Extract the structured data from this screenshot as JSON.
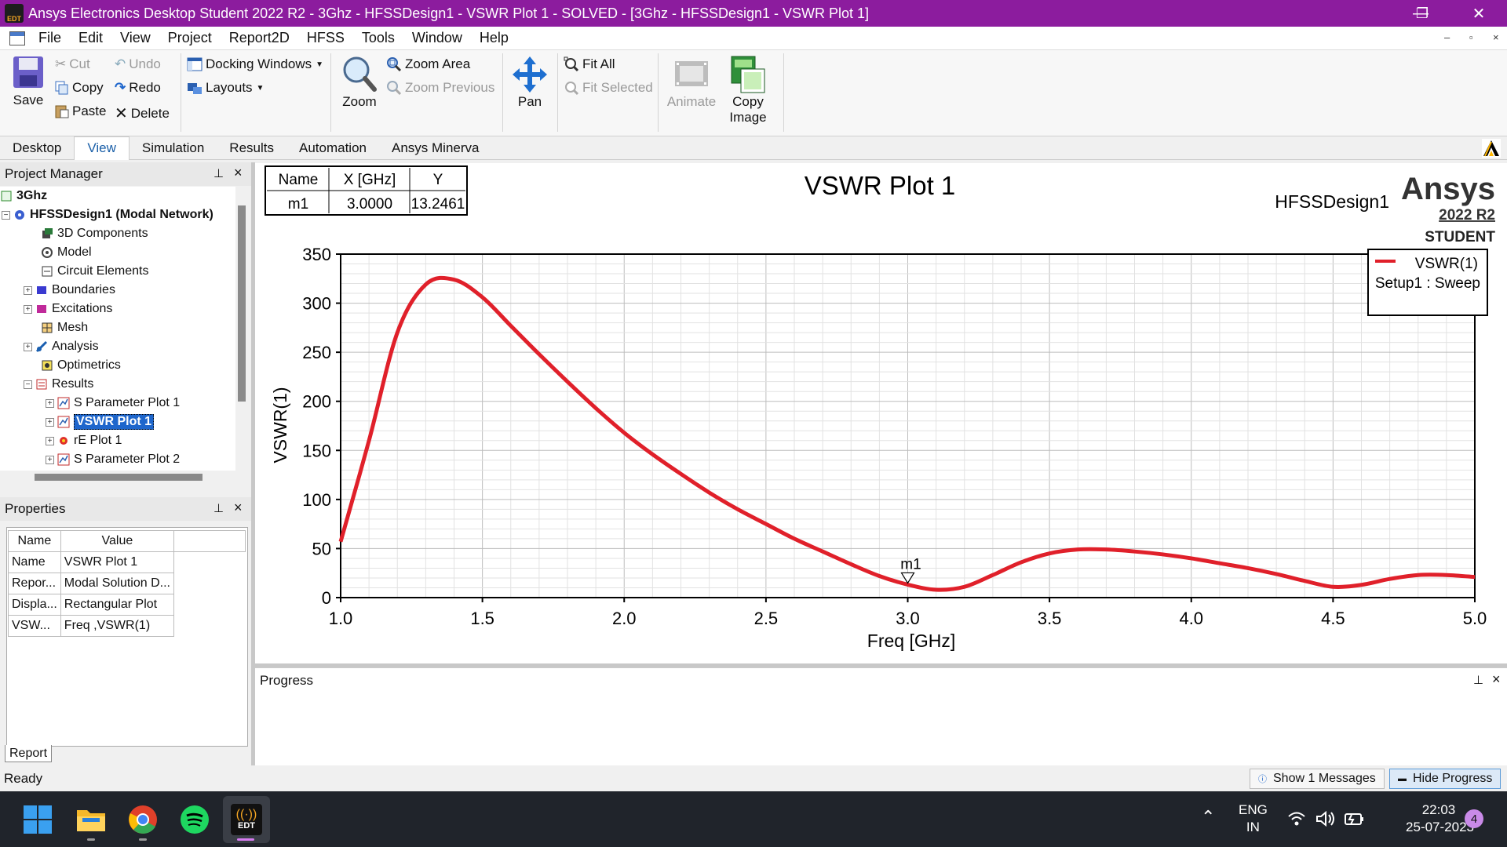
{
  "window": {
    "title": "Ansys Electronics Desktop Student 2022 R2 - 3Ghz - HFSSDesign1 - VSWR Plot 1 - SOLVED - [3Ghz - HFSSDesign1 - VSWR Plot 1]",
    "app_badge": "EDT",
    "minimize": "—",
    "restore": "❐",
    "close": "✕"
  },
  "menu": {
    "items": [
      "File",
      "Edit",
      "View",
      "Project",
      "Report2D",
      "HFSS",
      "Tools",
      "Window",
      "Help"
    ],
    "mdi_minimize": "–",
    "mdi_restore": "▫",
    "mdi_close": "×"
  },
  "ribbon": {
    "save": "Save",
    "cut": "Cut",
    "copy": "Copy",
    "paste": "Paste",
    "undo": "Undo",
    "redo": "Redo",
    "delete": "Delete",
    "docking_windows": "Docking Windows",
    "layouts": "Layouts",
    "zoom": "Zoom",
    "zoom_area": "Zoom Area",
    "zoom_previous": "Zoom Previous",
    "pan": "Pan",
    "fit_all": "Fit All",
    "fit_selected": "Fit Selected",
    "animate": "Animate",
    "copy_image_1": "Copy",
    "copy_image_2": "Image"
  },
  "tabs": [
    "Desktop",
    "View",
    "Simulation",
    "Results",
    "Automation",
    "Ansys Minerva"
  ],
  "project_manager": {
    "title": "Project Manager",
    "pin": "⊥",
    "close": "×",
    "tree": {
      "project": "3Ghz",
      "design": "HFSSDesign1 (Modal Network)",
      "children": [
        "3D Components",
        "Model",
        "Circuit Elements",
        "Boundaries",
        "Excitations",
        "Mesh",
        "Analysis",
        "Optimetrics",
        "Results"
      ],
      "results": [
        "S Parameter Plot 1",
        "VSWR Plot 1",
        "rE Plot 1",
        "S Parameter Plot 2"
      ]
    }
  },
  "properties": {
    "title": "Properties",
    "pin": "⊥",
    "close": "×",
    "headers": [
      "Name",
      "Value"
    ],
    "rows": [
      [
        "Name",
        "VSWR Plot 1"
      ],
      [
        "Repor...",
        "Modal Solution D..."
      ],
      [
        "Displa...",
        "Rectangular Plot"
      ],
      [
        "VSW...",
        "Freq ,VSWR(1)"
      ]
    ],
    "tab": "Report"
  },
  "plot": {
    "design_label": "HFSSDesign1",
    "brand": "Ansys",
    "version": "2022 R2",
    "edition": "STUDENT",
    "marker_table": {
      "headers": [
        "Name",
        "X [GHz]",
        "Y"
      ],
      "row": [
        "m1",
        "3.0000",
        "13.2461"
      ]
    },
    "legend": {
      "line1": "VSWR(1)",
      "line2": "Setup1 : Sweep"
    },
    "marker_label": "m1"
  },
  "chart_data": {
    "type": "line",
    "title": "VSWR Plot 1",
    "xlabel": "Freq [GHz]",
    "ylabel": "VSWR(1)",
    "xlim": [
      1.0,
      5.0
    ],
    "ylim": [
      0,
      350
    ],
    "xticks": [
      "1.0",
      "1.5",
      "2.0",
      "2.5",
      "3.0",
      "3.5",
      "4.0",
      "4.5",
      "5.0"
    ],
    "yticks": [
      "0",
      "50",
      "100",
      "150",
      "200",
      "250",
      "300",
      "350"
    ],
    "grid": true,
    "legend_position": "top-right",
    "series": [
      {
        "name": "VSWR(1)",
        "color": "#e0202a",
        "x": [
          1.0,
          1.1,
          1.2,
          1.3,
          1.4,
          1.5,
          1.6,
          1.7,
          1.8,
          1.9,
          2.0,
          2.1,
          2.2,
          2.3,
          2.4,
          2.5,
          2.6,
          2.7,
          2.8,
          2.9,
          3.0,
          3.1,
          3.2,
          3.3,
          3.4,
          3.5,
          3.6,
          3.7,
          3.8,
          3.9,
          4.0,
          4.1,
          4.2,
          4.3,
          4.4,
          4.5,
          4.6,
          4.7,
          4.8,
          4.9,
          5.0
        ],
        "y": [
          57,
          160,
          270,
          319,
          324,
          306,
          277,
          248,
          220,
          193,
          168,
          146,
          126,
          107,
          90,
          75,
          60,
          47,
          34,
          22,
          13.2461,
          8,
          11,
          23,
          36,
          45,
          49,
          49,
          47,
          44,
          40,
          35,
          30,
          24,
          17,
          11,
          13,
          19,
          23,
          23,
          21
        ]
      }
    ],
    "markers": [
      {
        "name": "m1",
        "x": 3.0,
        "y": 13.2461
      }
    ]
  },
  "progress": {
    "title": "Progress",
    "pin": "⊥",
    "close": "×"
  },
  "status": {
    "text": "Ready",
    "show_messages": "Show 1 Messages",
    "hide_progress": "Hide Progress"
  },
  "taskbar": {
    "lang1": "ENG",
    "lang2": "IN",
    "time": "22:03",
    "date": "25-07-2023",
    "notif_count": "4",
    "edt": "EDT"
  }
}
